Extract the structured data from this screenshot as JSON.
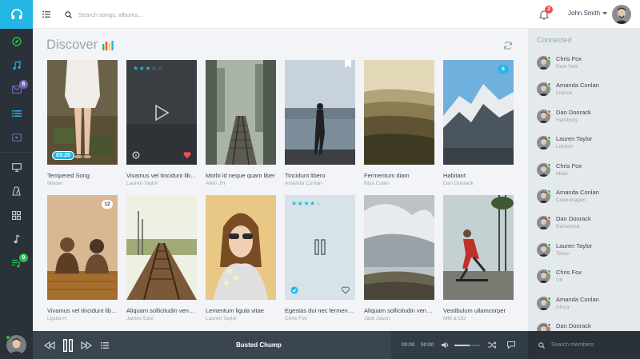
{
  "colors": {
    "accent": "#23b7e5",
    "success": "#27c24c",
    "danger": "#f05050",
    "info": "#7266ba",
    "sidebar": "#2a3138"
  },
  "sidebar": {
    "brand_icon": "headphones-icon",
    "items": [
      {
        "icon": "compass-icon",
        "badge": ""
      },
      {
        "icon": "music-note-icon",
        "badge": ""
      },
      {
        "icon": "envelope-icon",
        "badge": "6"
      },
      {
        "icon": "list-icon",
        "badge": ""
      },
      {
        "icon": "video-icon",
        "badge": ""
      },
      {
        "icon": "monitor-icon",
        "badge": ""
      },
      {
        "icon": "metronome-icon",
        "badge": ""
      },
      {
        "icon": "grid-icon",
        "badge": ""
      },
      {
        "icon": "music-note-single-icon",
        "badge": ""
      },
      {
        "icon": "playlist-icon",
        "badge": "9"
      }
    ]
  },
  "header": {
    "search_placeholder": "Search songs, albums...",
    "notifications_count": "2",
    "user_name": "John.Smith"
  },
  "main": {
    "title": "Discover",
    "cards": [
      {
        "title": "Tempered Song",
        "artist": "Miaow",
        "duration": "03:20",
        "badge": "",
        "stars": 0
      },
      {
        "title": "Vivamus vel tincidunt libero, vitae",
        "artist": "Lauren Taylor",
        "duration": "",
        "badge": "",
        "stars": 3
      },
      {
        "title": "Morbi id neque quam liber",
        "artist": "Allen JH",
        "duration": "",
        "badge": "",
        "stars": 0
      },
      {
        "title": "Tincidunt libero",
        "artist": "Amanda Conlan",
        "duration": "",
        "badge": "",
        "stars": 0
      },
      {
        "title": "Fermentum diam",
        "artist": "Nisa Colen",
        "duration": "",
        "badge": "",
        "stars": 0
      },
      {
        "title": "Habitant",
        "artist": "Dan Doorack",
        "duration": "",
        "badge": "6",
        "stars": 0
      },
      {
        "title": "Vivamus vel tincidunt libero",
        "artist": "Ligula H",
        "duration": "",
        "badge": "12",
        "stars": 0
      },
      {
        "title": "Aliquam sollicitudin venenatis",
        "artist": "James East",
        "duration": "",
        "badge": "",
        "stars": 0
      },
      {
        "title": "Lementum ligula vitae",
        "artist": "Lauren Taylor",
        "duration": "",
        "badge": "",
        "stars": 0
      },
      {
        "title": "Egestas dui nec fermentum",
        "artist": "Chris Fox",
        "duration": "",
        "badge": "",
        "stars": 4
      },
      {
        "title": "Aliquam sollicitudin venenatis",
        "artist": "Jack Jason",
        "duration": "",
        "badge": "",
        "stars": 0
      },
      {
        "title": "Vestibulum ullamcorper",
        "artist": "MM & DD",
        "duration": "",
        "badge": "",
        "stars": 0
      }
    ]
  },
  "right_panel": {
    "title": "Connected",
    "members": [
      {
        "name": "Chris Fox",
        "location": "New York",
        "status": "#27c24c"
      },
      {
        "name": "Amanda Conlan",
        "location": "France",
        "status": "#27c24c"
      },
      {
        "name": "Dan Doorack",
        "location": "Hamburg",
        "status": "#f05050"
      },
      {
        "name": "Lauren Taylor",
        "location": "London",
        "status": "#27c24c"
      },
      {
        "name": "Chris Fox",
        "location": "Milan",
        "status": "#27c24c"
      },
      {
        "name": "Amanda Conlan",
        "location": "Copenhagen",
        "status": "#27c24c"
      },
      {
        "name": "Dan Doorack",
        "location": "Barcelona",
        "status": "#f05050"
      },
      {
        "name": "Lauren Taylor",
        "location": "Tokyo",
        "status": "#27c24c"
      },
      {
        "name": "Chris Fox",
        "location": "UK",
        "status": "#27c24c"
      },
      {
        "name": "Amanda Conlan",
        "location": "Africa",
        "status": "#27c24c"
      },
      {
        "name": "Dan Doorack",
        "location": "",
        "status": "#f05050"
      }
    ]
  },
  "player": {
    "now_playing": "Busted Chump",
    "current_time": "00:00",
    "total_time": "00:00",
    "volume": 0.6,
    "members_search_placeholder": "Search members"
  }
}
